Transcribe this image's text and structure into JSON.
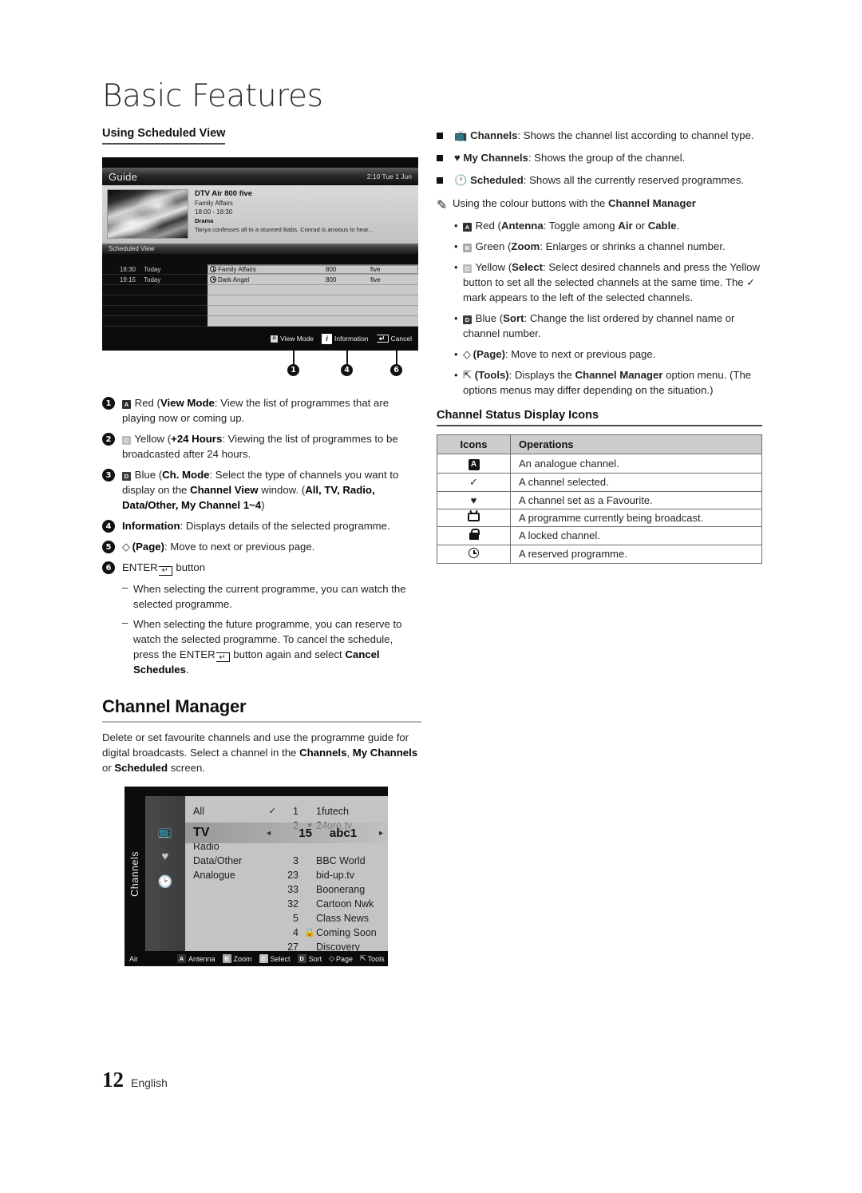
{
  "chapter_title": "Basic Features",
  "left": {
    "subheading": "Using Scheduled View",
    "guide_screenshot": {
      "title": "Guide",
      "clock": "2:10 Tue 1 Jun",
      "detail": {
        "channel": "DTV Air 800 five",
        "programme": "Family Affairs",
        "time": "18:00 - 18:30",
        "genre": "Drama",
        "synopsis": "Tanya confesses all to a stunned Babs. Conrad is anxious to hear..."
      },
      "section_label": "Scheduled View",
      "rows": [
        {
          "time": "18:30",
          "day": "Today",
          "name": "Family Affairs",
          "number": "800",
          "network": "five"
        },
        {
          "time": "19:15",
          "day": "Today",
          "name": "Dark Angel",
          "number": "800",
          "network": "five"
        }
      ],
      "buttons": [
        {
          "key": "A",
          "label": "View Mode"
        },
        {
          "key": "i",
          "label": "Information"
        },
        {
          "key": "enter",
          "label": "Cancel"
        }
      ],
      "callouts": [
        "1",
        "4",
        "6"
      ]
    },
    "numbered_items": [
      {
        "num": "1",
        "key": "A",
        "key_colour": "red",
        "colour_word": "Red",
        "bold_name": "View Mode",
        "body": ": View the list of programmes that are playing now or coming up."
      },
      {
        "num": "2",
        "key": "C",
        "key_colour": "yell",
        "colour_word": "Yellow",
        "bold_name": "+24 Hours",
        "body": ": Viewing the list of programmes to be broadcasted after 24 hours."
      },
      {
        "num": "3",
        "key": "D",
        "key_colour": "blue",
        "colour_word": "Blue",
        "bold_name": "Ch. Mode",
        "body": ": Select the type of channels you want to display on the ",
        "body2_bold": "Channel View",
        "body3": " window. (",
        "options": "All, TV, Radio, Data/Other, My Channel 1~4",
        "body4": ")"
      },
      {
        "num": "4",
        "bold_name": "Information",
        "body": ": Displays details of the selected programme."
      },
      {
        "num": "5",
        "glyph": "page",
        "bold_name": "(Page)",
        "body": ": Move to next or previous page."
      },
      {
        "num": "6",
        "enter_label": "ENTER",
        "body": " button",
        "dashes": [
          "When selecting the current programme, you can watch the selected programme.",
          "When selecting the future programme, you can reserve to watch the selected programme. To cancel the schedule, press the ENTER button again and select Cancel Schedules."
        ]
      }
    ],
    "channel_manager": {
      "heading": "Channel Manager",
      "paragraph_plain_1": "Delete or set favourite channels and use the programme guide for digital broadcasts. Select a channel in the ",
      "paragraph_bold_1": "Channels",
      "paragraph_plain_2": ", ",
      "paragraph_bold_2": "My Channels",
      "paragraph_plain_3": " or ",
      "paragraph_bold_3": "Scheduled",
      "paragraph_plain_4": " screen.",
      "screenshot": {
        "vertical_tab": "Channels",
        "sidebar_icons": [
          "channels-icon",
          "heart-icon",
          "clock-icon"
        ],
        "categories": [
          "All",
          "TV",
          "Radio",
          "Data/Other",
          "Analogue"
        ],
        "highlight": {
          "category": "TV",
          "number": "15",
          "name": "abc1"
        },
        "channels": [
          {
            "mark": "✓",
            "number": "1",
            "fav": "",
            "name": "1futech"
          },
          {
            "mark": "",
            "number": "2",
            "fav": "♥",
            "name": "24ore.tv"
          },
          {
            "mark": "",
            "number": "3",
            "fav": "",
            "name": "BBC World"
          },
          {
            "mark": "",
            "number": "23",
            "fav": "",
            "name": "bid-up.tv"
          },
          {
            "mark": "",
            "number": "33",
            "fav": "",
            "name": "Boonerang"
          },
          {
            "mark": "",
            "number": "32",
            "fav": "",
            "name": "Cartoon Nwk"
          },
          {
            "mark": "",
            "number": "5",
            "fav": "",
            "name": "Class News"
          },
          {
            "mark": "",
            "number": "4",
            "fav": "lock",
            "name": "Coming Soon"
          },
          {
            "mark": "",
            "number": "27",
            "fav": "",
            "name": "Discovery"
          }
        ],
        "bottom_bar": {
          "source": "Air",
          "buttons": [
            {
              "key": "A",
              "label": "Antenna",
              "colour": "red"
            },
            {
              "key": "B",
              "label": "Zoom",
              "colour": "green"
            },
            {
              "key": "C",
              "label": "Select",
              "colour": "yell"
            },
            {
              "key": "D",
              "label": "Sort",
              "colour": "blue"
            },
            {
              "key": "page",
              "label": "Page",
              "colour": "none"
            },
            {
              "key": "tools",
              "label": "Tools",
              "colour": "none"
            }
          ]
        }
      }
    }
  },
  "right": {
    "square_items": [
      {
        "icon": "channels-icon",
        "bold": "Channels",
        "body": ": Shows the channel list according to channel type."
      },
      {
        "icon": "heart-icon",
        "bold": "My Channels",
        "body": ": Shows the group of the channel."
      },
      {
        "icon": "stopwatch-icon",
        "bold": "Scheduled",
        "body": ": Shows all the currently reserved programmes."
      }
    ],
    "note": {
      "lead": "Using the colour buttons with the ",
      "bold": "Channel Manager"
    },
    "dot_items": [
      {
        "key": "A",
        "key_colour": "red",
        "colour_word": "Red",
        "bold_name": "Antenna",
        "body": ": Toggle among ",
        "bold_a": "Air",
        "mid": " or ",
        "bold_b": "Cable",
        "tail": "."
      },
      {
        "key": "B",
        "key_colour": "green",
        "colour_word": "Green",
        "bold_name": "Zoom",
        "body": ": Enlarges or shrinks a channel number."
      },
      {
        "key": "C",
        "key_colour": "yell",
        "colour_word": "Yellow",
        "bold_name": "Select",
        "body": ": Select desired channels and press the Yellow button to set all the selected channels at the same time. The ✓ mark appears to the left of the selected channels."
      },
      {
        "key": "D",
        "key_colour": "blue",
        "colour_word": "Blue",
        "bold_name": "Sort",
        "body": ": Change the list ordered by channel name or channel number."
      },
      {
        "key": "page",
        "key_colour": "none",
        "colour_word": "",
        "bold_name": "(Page)",
        "body": ": Move to next or previous page."
      },
      {
        "key": "tools",
        "key_colour": "none",
        "colour_word": "",
        "bold_name": "(Tools)",
        "body": ": Displays the ",
        "bold_a": "Channel Manager",
        "mid": " option menu. (The options menus may differ depending on the situation.)"
      }
    ],
    "icons_section": {
      "heading": "Channel Status Display Icons",
      "columns": [
        "Icons",
        "Operations"
      ],
      "rows": [
        {
          "icon": "analogue-icon",
          "glyph": "A",
          "operation": "An analogue channel."
        },
        {
          "icon": "check-icon",
          "glyph": "✓",
          "operation": "A channel selected."
        },
        {
          "icon": "heart-icon",
          "glyph": "♥",
          "operation": "A channel set as a Favourite."
        },
        {
          "icon": "tv-icon",
          "glyph": "",
          "operation": "A programme currently being broadcast."
        },
        {
          "icon": "lock-icon",
          "glyph": "",
          "operation": "A locked channel."
        },
        {
          "icon": "clock-icon",
          "glyph": "",
          "operation": "A reserved programme."
        }
      ]
    }
  },
  "footer": {
    "page_number": "12",
    "language": "English"
  }
}
